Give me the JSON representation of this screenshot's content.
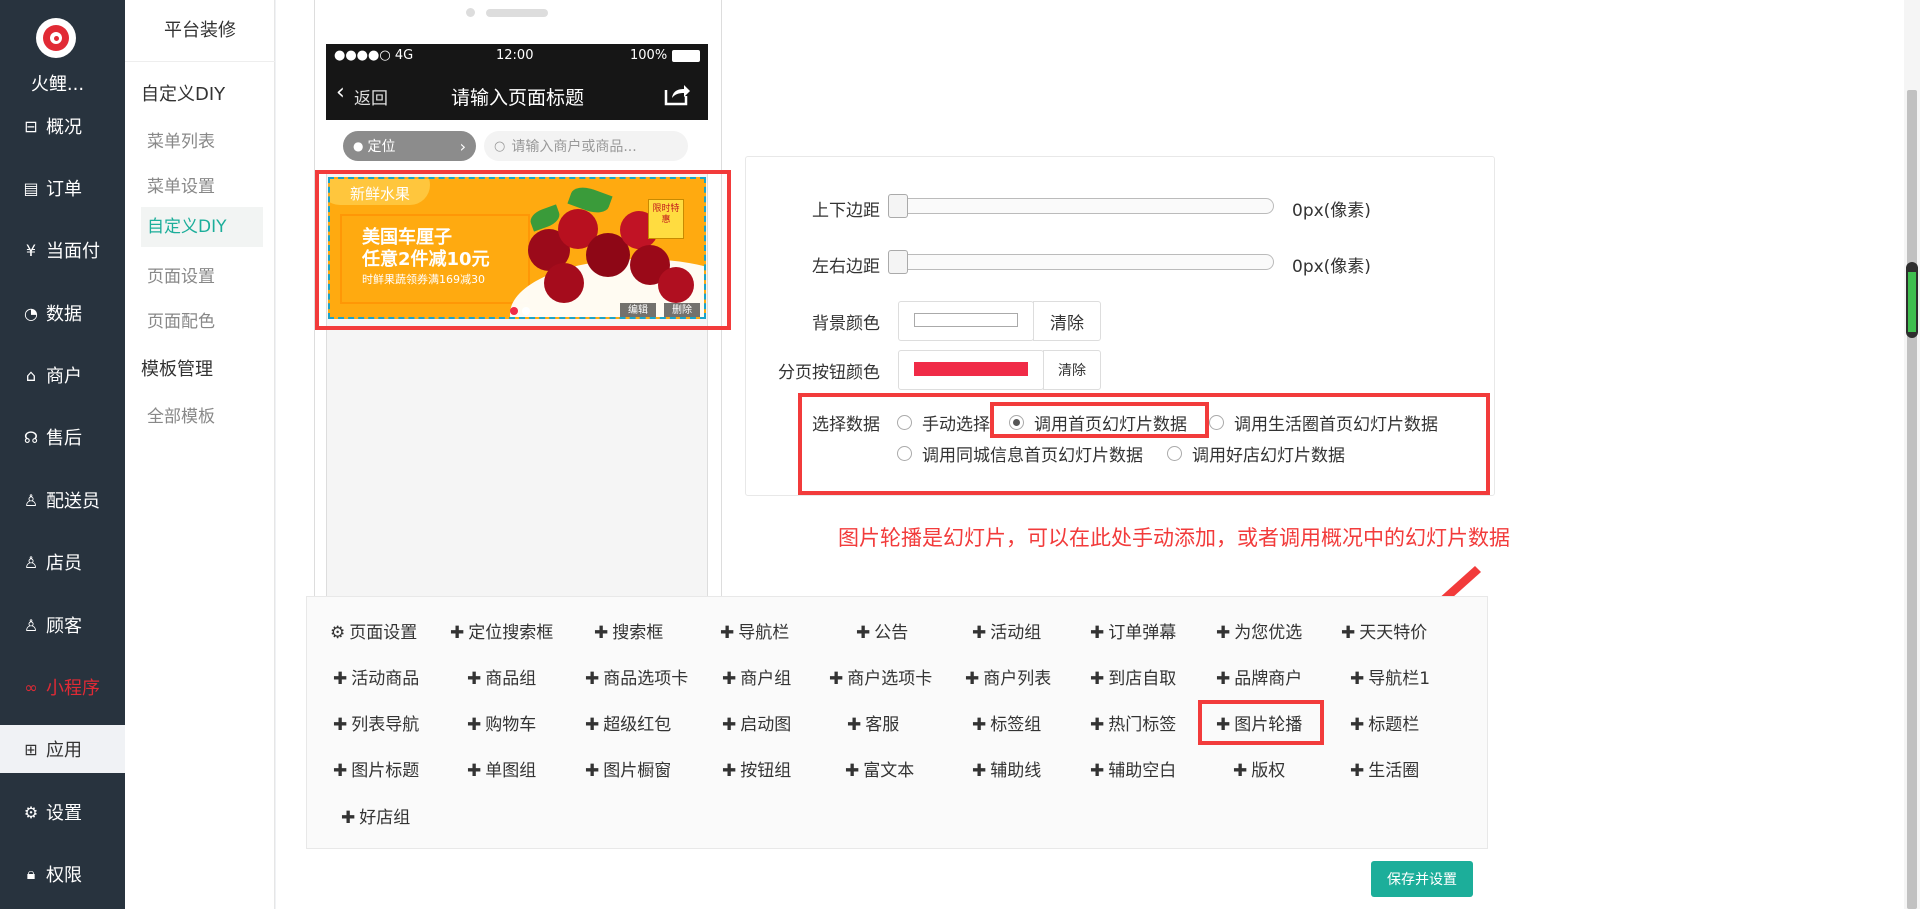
{
  "nav": {
    "brand": "火鲤...",
    "items": [
      {
        "label": "概况",
        "icon": "dashboard-icon"
      },
      {
        "label": "订单",
        "icon": "order-icon"
      },
      {
        "label": "当面付",
        "icon": "yen-icon"
      },
      {
        "label": "数据",
        "icon": "chart-icon"
      },
      {
        "label": "商户",
        "icon": "store-icon"
      },
      {
        "label": "售后",
        "icon": "service-icon"
      },
      {
        "label": "配送员",
        "icon": "courier-icon"
      },
      {
        "label": "店员",
        "icon": "staff-icon"
      },
      {
        "label": "顾客",
        "icon": "customer-icon"
      },
      {
        "label": "小程序",
        "icon": "miniprogram-icon"
      },
      {
        "label": "应用",
        "icon": "apps-icon"
      },
      {
        "label": "设置",
        "icon": "gear-icon"
      },
      {
        "label": "权限",
        "icon": "lock-icon"
      }
    ]
  },
  "sub": {
    "title": "平台装修",
    "groups": [
      "自定义DIY",
      "模板管理"
    ],
    "items": [
      "菜单列表",
      "菜单设置",
      "自定义DIY",
      "页面设置",
      "页面配色",
      "全部模板"
    ]
  },
  "phone": {
    "signal": "●●●●○ 4G",
    "time": "12:00",
    "battery": "100%",
    "back": "返回",
    "title": "请输入页面标题",
    "location": "定位",
    "search_placeholder": "请输入商户或商品...",
    "banner": {
      "tag": "新鲜水果",
      "line1": "美国车厘子",
      "line2": "任意2件减10元",
      "line3": "时鲜果蔬领券满169减30",
      "badge": "限时特惠",
      "edit": "编辑",
      "delete": "删除"
    }
  },
  "panel": {
    "margin_tb_label": "上下边距",
    "margin_tb_value": "0px(像素)",
    "margin_lr_label": "左右边距",
    "margin_lr_value": "0px(像素)",
    "bg_color_label": "背景颜色",
    "bg_color": "#ffffff",
    "clear": "清除",
    "page_btn_color_label": "分页按钮颜色",
    "page_btn_color": "#f02b47",
    "clear2": "清除",
    "data_label": "选择数据",
    "options": [
      "手动选择",
      "调用首页幻灯片数据",
      "调用生活圈首页幻灯片数据",
      "调用同城信息首页幻灯片数据",
      "调用好店幻灯片数据"
    ],
    "selected": "调用首页幻灯片数据"
  },
  "note": "图片轮播是幻灯片，可以在此处手动添加，或者调用概况中的幻灯片数据",
  "palette": {
    "first": "页面设置",
    "items": [
      "定位搜索框",
      "搜索框",
      "导航栏",
      "公告",
      "活动组",
      "订单弹幕",
      "为您优选",
      "天天特价",
      "活动商品",
      "商品组",
      "商品选项卡",
      "商户组",
      "商户选项卡",
      "商户列表",
      "到店自取",
      "品牌商户",
      "导航栏1",
      "列表导航",
      "购物车",
      "超级红包",
      "启动图",
      "客服",
      "标签组",
      "热门标签",
      "图片轮播",
      "标题栏",
      "图片标题",
      "单图组",
      "图片橱窗",
      "按钮组",
      "富文本",
      "辅助线",
      "辅助空白",
      "版权",
      "生活圈",
      "好店组"
    ]
  },
  "save": "保存并设置",
  "colors": {
    "accent": "#1cae9a",
    "highlight": "#f23b3b",
    "nav_bg": "#28333e"
  }
}
